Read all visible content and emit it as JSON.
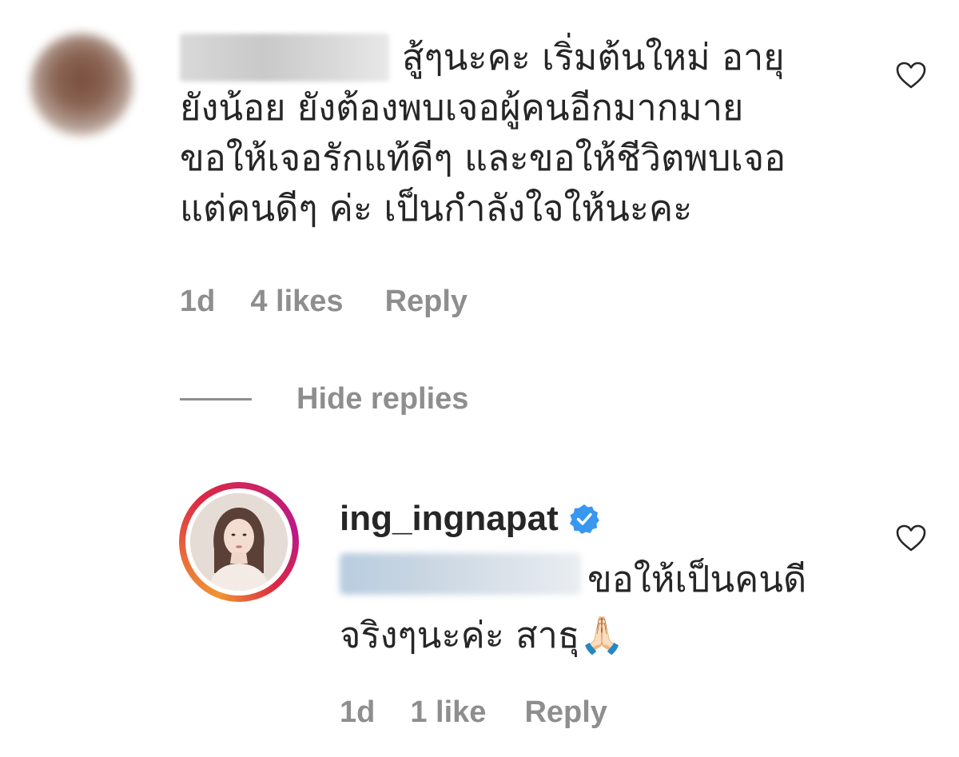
{
  "comment": {
    "text_lines": [
      "สู้ๆนะคะ เริ่มต้นใหม่ อายุ",
      "ยังน้อย ยังต้องพบเจอผู้คนอีกมากมาย",
      "ขอให้เจอรักแท้ดีๆ และขอให้ชีวิตพบเจอ",
      "แต่คนดีๆ ค่ะ เป็นกำลังใจให้นะคะ"
    ],
    "time": "1d",
    "likes": "4 likes",
    "reply_label": "Reply",
    "like_icon": "heart-outline-icon"
  },
  "thread": {
    "hide_replies_label": "Hide replies"
  },
  "reply": {
    "username": "ing_ingnapat",
    "verified": true,
    "text_lines": [
      "ขอให้เป็นคนดี",
      "จริงๆนะค่ะ สาธุ🙏🏻"
    ],
    "time": "1d",
    "likes": "1 like",
    "reply_label": "Reply",
    "like_icon": "heart-outline-icon",
    "ring_colors": [
      "#f09433",
      "#dc2743",
      "#bc1888"
    ],
    "verified_color": "#3897f0"
  }
}
